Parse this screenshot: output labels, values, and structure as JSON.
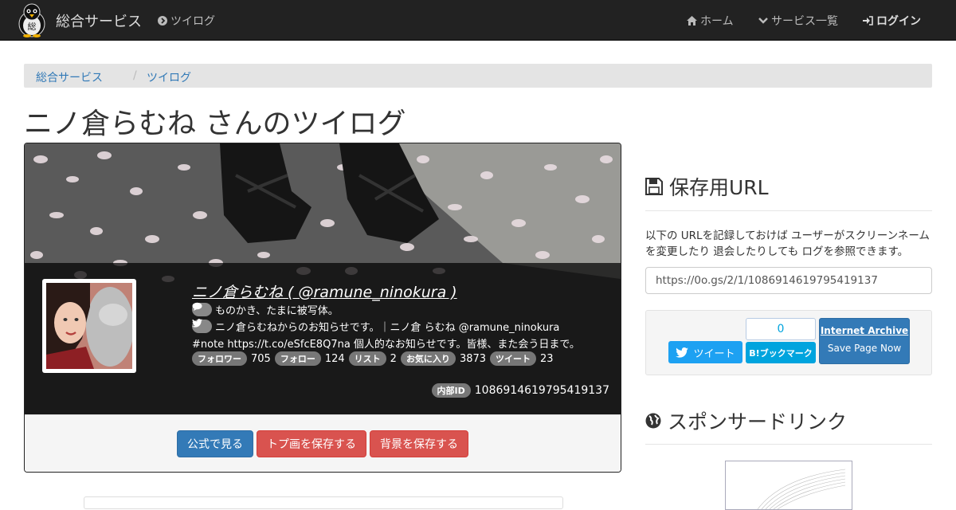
{
  "navbar": {
    "brand": "総合サービス",
    "section_link": "ツイログ",
    "home": "ホーム",
    "services": "サービス一覧",
    "login": "ログイン"
  },
  "breadcrumb": [
    "総合サービス",
    "ツイログ"
  ],
  "page_title": "ニノ倉らむね さんのツイログ",
  "profile": {
    "display_name": "ニノ倉らむね ( @ramune_ninokura )",
    "location": "ものかき、たまに被写体。",
    "bio_line1": "ニノ倉らむねからのお知らせです。｜ニノ倉 らむね @ramune_ninokura",
    "bio_line2": "#note https://t.co/eSfcE8Q7na 個人的なお知らせです。皆様、また会う日まで。",
    "stats": [
      {
        "label": "フォロワー",
        "value": "705"
      },
      {
        "label": "フォロー",
        "value": "124"
      },
      {
        "label": "リスト",
        "value": "2"
      },
      {
        "label": "お気に入り",
        "value": "3873"
      },
      {
        "label": "ツイート",
        "value": "23"
      }
    ],
    "internal_id_label": "内部ID",
    "internal_id": "1086914619795419137"
  },
  "buttons": {
    "official": "公式で見る",
    "save_avatar": "トプ画を保存する",
    "save_background": "背景を保存する"
  },
  "sidebar": {
    "save_url_heading": "保存用URL",
    "description": "以下の URLを記録しておけば ユーザーがスクリーンネームを変更したり 退会したりしても ログを参照できます。",
    "saved_url": "https://0o.gs/2/1/1086914619795419137",
    "tweet_button": "ツイート",
    "hatena_count": "0",
    "hatena_button": "B!ブックマーク",
    "ia_title": "Internet Archive",
    "ia_sub": "Save Page Now",
    "sponsored_heading": "スポンサードリンク"
  },
  "colors": {
    "navbar": "#222222",
    "link": "#337ab7",
    "danger": "#d9534f",
    "twitter": "#1da1f2",
    "hatena": "#00a4de"
  }
}
